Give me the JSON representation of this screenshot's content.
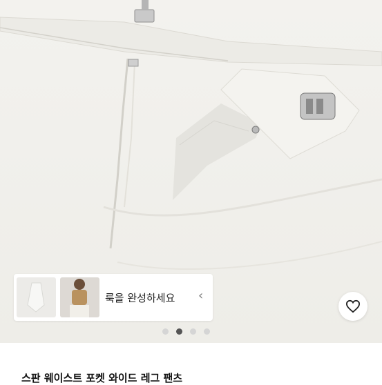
{
  "product": {
    "look_prompt": "룩을 완성하세요",
    "title": "스판 웨이스트 포켓 와이드 레그 팬츠"
  },
  "carousel": {
    "total": 4,
    "active_index": 1
  },
  "icons": {
    "heart": "heart-icon",
    "chevron": "chevron-left-icon"
  },
  "colors": {
    "fabric": "#f1f0ec",
    "active_dot": "#555555",
    "inactive_dot": "#d5d5d5"
  }
}
